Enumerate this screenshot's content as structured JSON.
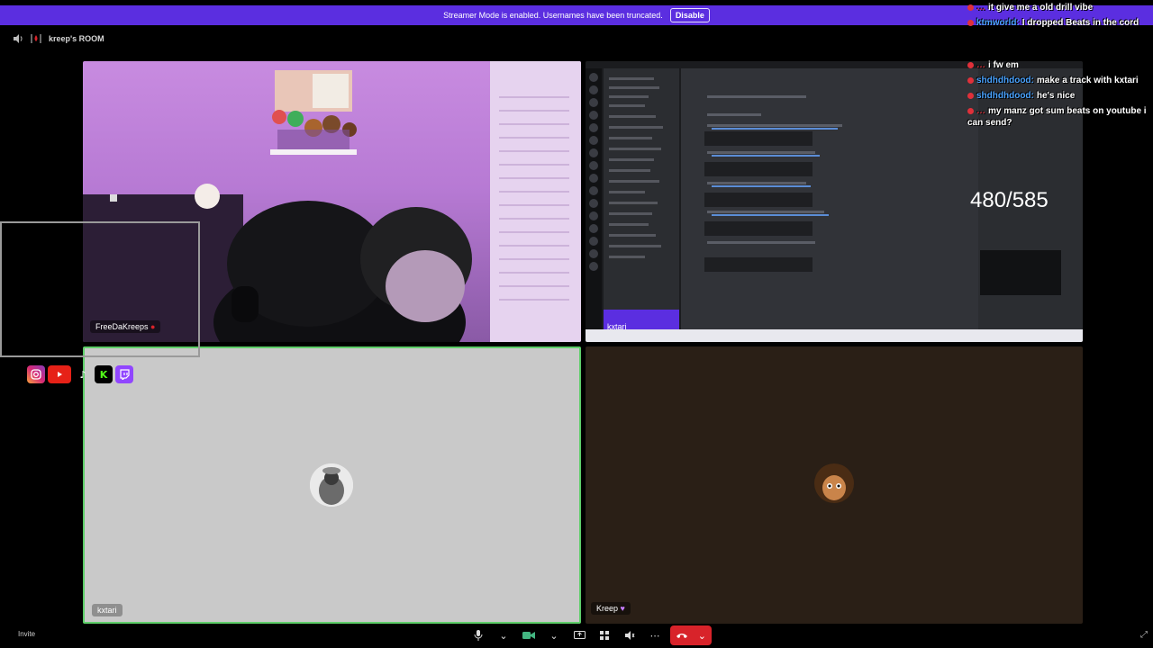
{
  "banner": {
    "message": "Streamer Mode is enabled. Usernames have been truncated.",
    "disable_label": "Disable",
    "color": "#5b2ee0"
  },
  "room": {
    "title": "kreep's ROOM"
  },
  "tiles": {
    "webcam": {
      "name": "FreeDaKreeps"
    },
    "screenshare": {
      "sidebar_user": "kxtari"
    },
    "user3": {
      "name": "kxtari"
    },
    "user4": {
      "name": "Kreep"
    }
  },
  "chat": {
    "messages": [
      {
        "user": "…",
        "text": "it give me a old drill vibe",
        "user_color": "#e0303a"
      },
      {
        "user": "ktmworld:",
        "text": "I dropped Beats in the cord",
        "user_color": "#4aa3ff"
      },
      {
        "user": "…",
        "text": "i fw em",
        "user_color": "#e0303a"
      },
      {
        "user": "shdhdhdood:",
        "text": "make a track with kxtari",
        "user_color": "#4aa3ff"
      },
      {
        "user": "shdhdhdood:",
        "text": "he's nice",
        "user_color": "#4aa3ff"
      },
      {
        "user": "…",
        "text": "my manz got sum beats on youtube i can send?",
        "user_color": "#e0303a"
      }
    ],
    "counter": "480/585"
  },
  "socials": [
    "instagram",
    "youtube",
    "tiktok",
    "kick",
    "twitch"
  ],
  "controls": {
    "invite_label": "Invite"
  },
  "colors": {
    "speaking_border": "#5fcf6a",
    "end_call": "#d8232a"
  }
}
